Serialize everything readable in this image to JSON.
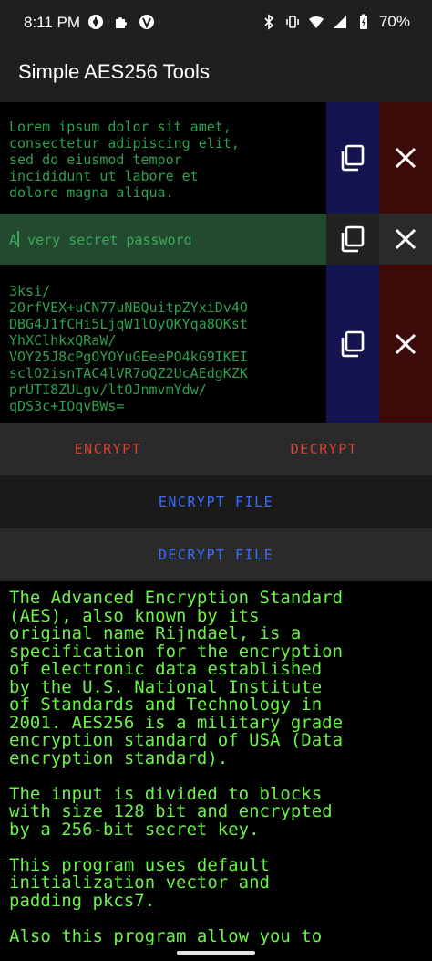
{
  "status": {
    "time": "8:11 PM",
    "battery_percent": "70%"
  },
  "app": {
    "title": "Simple AES256 Tools"
  },
  "plaintext": {
    "lines": [
      "Lorem ipsum dolor sit amet,",
      "consectetur adipiscing elit,",
      "sed do eiusmod tempor",
      "incididunt ut labore et",
      "dolore magna aliqua."
    ]
  },
  "password": {
    "value": "A very secret password"
  },
  "ciphertext": {
    "lines": [
      "3ksi/",
      "2OrfVEX+uCN77uNBQuitpZYxiDv4O",
      "DBG4J1fCHi5LjqW1lOyQKYqa8QKst",
      "YhXClhkxQRaW/",
      "VOY25J8cPgOYOYuGEeePO4kG9IKEI",
      "sclO2isnTAC4lVR7oQZ2UcAEdgKZK",
      "prUTI8ZULgv/ltOJnmvmYdw/",
      "qDS3c+IOqvBWs="
    ]
  },
  "buttons": {
    "encrypt": "ENCRYPT",
    "decrypt": "DECRYPT",
    "encrypt_file": "ENCRYPT FILE",
    "decrypt_file": "DECRYPT FILE"
  },
  "info": {
    "paragraphs": [
      "The Advanced Encryption Standard\n(AES), also known by its\noriginal name Rijndael, is a\nspecification for the encryption\nof electronic data established\nby the U.S. National Institute\nof Standards and Technology in\n2001. AES256 is a military grade\nencryption standard of USA (Data\nencryption standard).",
      "The input is divided to blocks\nwith size 128 bit and encrypted\nby a 256-bit secret key.",
      "This program uses default\ninitialization vector and\npadding pkcs7.",
      "Also this program allow you to"
    ]
  },
  "colors": {
    "plain_text": "#2ea04c",
    "copy_column": "#141450",
    "clear_column": "#3d0a0a",
    "password_bg": "#234a2f",
    "encrypt_button": "#d9402f",
    "file_button": "#3d6bff",
    "info_text": "#6cf24a"
  },
  "icons": [
    "copy-icon",
    "close-icon",
    "bluetooth-icon",
    "vibrate-icon",
    "wifi-icon",
    "signal-icon",
    "battery-charging-icon"
  ]
}
